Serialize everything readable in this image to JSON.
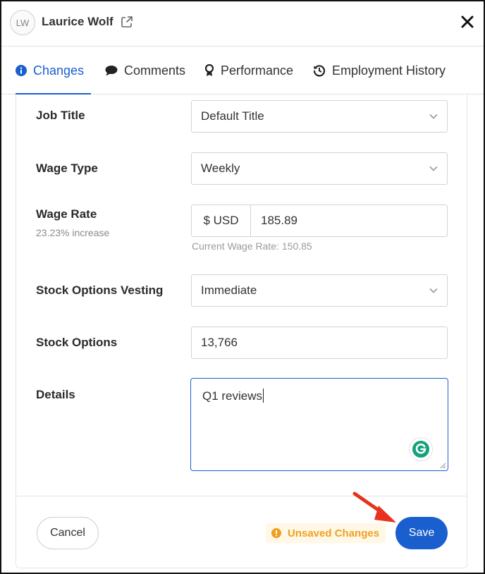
{
  "header": {
    "avatar_initials": "LW",
    "user_name": "Laurice Wolf",
    "external_link_icon": "external-link-icon",
    "close_icon": "close-icon"
  },
  "tabs": [
    {
      "label": "Changes",
      "icon": "info-circle-icon",
      "active": true
    },
    {
      "label": "Comments",
      "icon": "comment-icon",
      "active": false
    },
    {
      "label": "Performance",
      "icon": "award-ribbon-icon",
      "active": false
    },
    {
      "label": "Employment History",
      "icon": "history-icon",
      "active": false
    }
  ],
  "form": {
    "job_title": {
      "label": "Job Title",
      "value": "Default Title"
    },
    "wage_type": {
      "label": "Wage Type",
      "value": "Weekly"
    },
    "wage_rate": {
      "label": "Wage Rate",
      "sub_label": "23.23% increase",
      "currency": "$ USD",
      "value": "185.89",
      "hint": "Current Wage Rate: 150.85"
    },
    "stock_vesting": {
      "label": "Stock Options Vesting",
      "value": "Immediate"
    },
    "stock_options": {
      "label": "Stock Options",
      "value": "13,766"
    },
    "details": {
      "label": "Details",
      "value": "Q1 reviews"
    }
  },
  "footer": {
    "cancel_label": "Cancel",
    "unsaved_label": "Unsaved Changes",
    "save_label": "Save"
  },
  "colors": {
    "accent": "#1a5fce",
    "warning": "#f0a020",
    "annotation_arrow": "#e8321e"
  }
}
